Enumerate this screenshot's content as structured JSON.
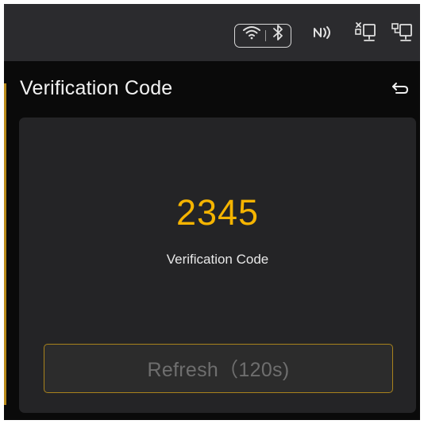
{
  "status_bar": {
    "icons": [
      "wifi-icon",
      "bluetooth-icon",
      "nfc-icon",
      "network-disconnected-icon",
      "network-connected-icon"
    ]
  },
  "header": {
    "title": "Verification Code",
    "back_icon": "back-arrow-icon"
  },
  "verification": {
    "code": "2345",
    "caption": "Verification Code"
  },
  "refresh_button": {
    "label": "Refresh（120s)"
  },
  "colors": {
    "accent": "#f5b400",
    "button_border": "#a8821c",
    "card_bg": "#242426",
    "status_bar_bg": "#2b2b2e",
    "screen_bg": "#0a0a0a"
  }
}
